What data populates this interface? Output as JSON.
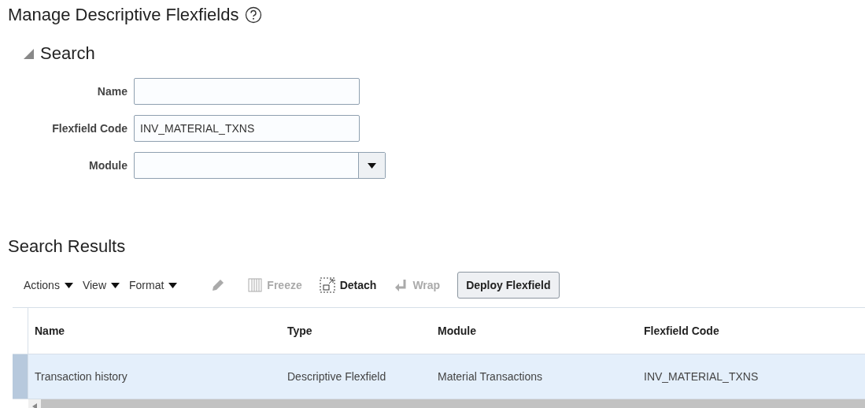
{
  "title": "Manage Descriptive Flexfields",
  "search": {
    "title": "Search",
    "expanded": true,
    "fields": [
      {
        "kind": "text",
        "label": "Name"
      },
      {
        "kind": "text",
        "label": "Flexfield Code",
        "value": "INV_MATERIAL_TXNS"
      },
      {
        "kind": "select",
        "label": "Module"
      }
    ]
  },
  "results": {
    "title": "Search Results",
    "toolbar": [
      {
        "kind": "menu",
        "label": "Actions"
      },
      {
        "kind": "menu",
        "label": "View"
      },
      {
        "kind": "menu",
        "label": "Format"
      },
      {
        "kind": "edit",
        "disabled": true
      },
      {
        "kind": "freeze",
        "label": "Freeze",
        "disabled": true
      },
      {
        "kind": "detach",
        "label": "Detach",
        "disabled": false
      },
      {
        "kind": "wrap",
        "label": "Wrap",
        "disabled": true
      },
      {
        "kind": "button",
        "label": "Deploy Flexfield"
      }
    ],
    "table": {
      "columns": [
        "Name",
        "Type",
        "Module",
        "Flexfield Code"
      ],
      "rows": [
        {
          "selected": true,
          "cells": [
            "Transaction history",
            "Descriptive Flexfield",
            "Material Transactions",
            "INV_MATERIAL_TXNS"
          ]
        }
      ]
    }
  }
}
